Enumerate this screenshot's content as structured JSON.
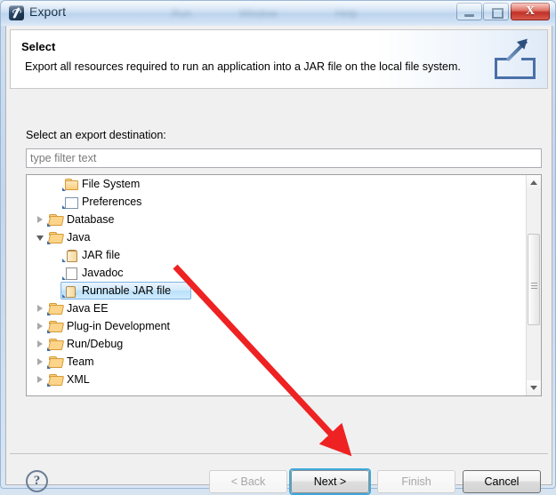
{
  "window": {
    "title": "Export",
    "app_icon": "eclipse-icon",
    "ghost_menus": [
      "Run",
      "Window",
      "Help"
    ],
    "controls": {
      "minimize": "minimize-button",
      "maximize": "maximize-button",
      "close_glyph": "X"
    }
  },
  "banner": {
    "title": "Select",
    "description": "Export all resources required to run an application into a JAR file on the local file system.",
    "icon": "export-wizard-icon"
  },
  "form": {
    "destination_label": "Select an export destination:",
    "filter_placeholder": "type filter text",
    "filter_value": ""
  },
  "tree": {
    "items": [
      {
        "label": "File System",
        "indent": 2,
        "twisty": "none",
        "icon": "folder-closed-icon",
        "selected": false
      },
      {
        "label": "Preferences",
        "indent": 2,
        "twisty": "none",
        "icon": "preferences-icon",
        "selected": false
      },
      {
        "label": "Database",
        "indent": 1,
        "twisty": "collapsed",
        "icon": "folder-open-icon",
        "selected": false
      },
      {
        "label": "Java",
        "indent": 1,
        "twisty": "expanded",
        "icon": "folder-open-icon",
        "selected": false
      },
      {
        "label": "JAR file",
        "indent": 2,
        "twisty": "none",
        "icon": "jar-icon",
        "selected": false
      },
      {
        "label": "Javadoc",
        "indent": 2,
        "twisty": "none",
        "icon": "javadoc-icon",
        "selected": false
      },
      {
        "label": "Runnable JAR file",
        "indent": 2,
        "twisty": "none",
        "icon": "runnable-jar-icon",
        "selected": true
      },
      {
        "label": "Java EE",
        "indent": 1,
        "twisty": "collapsed",
        "icon": "folder-open-icon",
        "selected": false
      },
      {
        "label": "Plug-in Development",
        "indent": 1,
        "twisty": "collapsed",
        "icon": "folder-open-icon",
        "selected": false
      },
      {
        "label": "Run/Debug",
        "indent": 1,
        "twisty": "collapsed",
        "icon": "folder-open-icon",
        "selected": false
      },
      {
        "label": "Team",
        "indent": 1,
        "twisty": "collapsed",
        "icon": "folder-open-icon",
        "selected": false
      },
      {
        "label": "XML",
        "indent": 1,
        "twisty": "collapsed",
        "icon": "folder-open-icon",
        "selected": false
      }
    ],
    "selected_label": "Runnable JAR file",
    "scrollbar": {
      "thumb_top_pct": 23,
      "thumb_height_pct": 48
    }
  },
  "footer": {
    "help": "?",
    "back_label": "< Back",
    "next_label": "Next >",
    "finish_label": "Finish",
    "cancel_label": "Cancel",
    "back_enabled": false,
    "next_enabled": true,
    "finish_enabled": false,
    "cancel_enabled": true,
    "focused_button": "Next >"
  },
  "annotation": {
    "color": "#ee2222",
    "from": "Runnable JAR file",
    "to": "Next >"
  }
}
